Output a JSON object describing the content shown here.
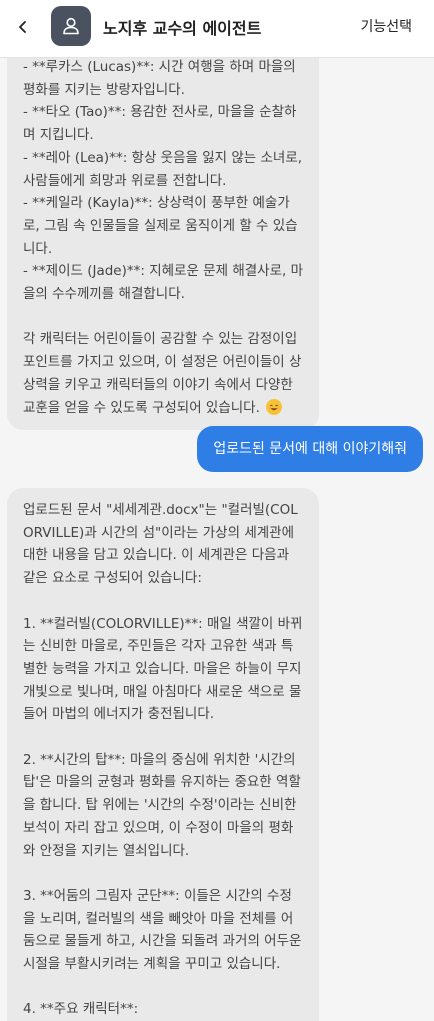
{
  "header": {
    "title": "노지후 교수의 에이전트",
    "feature_button": "기능선택"
  },
  "icons": {
    "back": "chevron-left-icon",
    "avatar": "user-icon",
    "emoji": "smiling-face-emoji"
  },
  "colors": {
    "user_bubble": "#2f7ee6",
    "ai_bubble": "#e9e9e9",
    "avatar_bg": "#4a5260"
  },
  "messages": [
    {
      "role": "assistant",
      "text": "- **루카스 (Lucas)**: 시간 여행을 하며 마을의 평화를 지키는 방랑자입니다.\n- **타오 (Tao)**: 용감한 전사로, 마을을 순찰하며 지킵니다.\n- **레아 (Lea)**: 항상 웃음을 잃지 않는 소녀로, 사람들에게 희망과 위로를 전합니다.\n- **케일라 (Kayla)**: 상상력이 풍부한 예술가로, 그림 속 인물들을 실제로 움직이게 할 수 있습니다.\n- **제이드 (Jade)**: 지혜로운 문제 해결사로, 마을의 수수께끼를 해결합니다.\n\n각 캐릭터는 어린이들이 공감할 수 있는 감정이입 포인트를 가지고 있으며, 이 설정은 어린이들이 상상력을 키우고 캐릭터들의 이야기 속에서 다양한 교훈을 얻을 수 있도록 구성되어 있습니다."
    },
    {
      "role": "user",
      "text": "업로드된 문서에 대해 이야기해줘"
    },
    {
      "role": "assistant",
      "text": "업로드된 문서 \"세세계관.docx\"는 \"컬러빌(COLORVILLE)과 시간의 섬\"이라는 가상의 세계관에 대한 내용을 담고 있습니다. 이 세계관은 다음과 같은 요소로 구성되어 있습니다:\n\n1. **컬러빌(COLORVILLE)**: 매일 색깔이 바뀌는 신비한 마을로, 주민들은 각자 고유한 색과 특별한 능력을 가지고 있습니다. 마을은 하늘이 무지개빛으로 빛나며, 매일 아침마다 새로운 색으로 물들어 마법의 에너지가 충전됩니다.\n\n2. **시간의 탑**: 마을의 중심에 위치한 '시간의 탑'은 마을의 균형과 평화를 유지하는 중요한 역할을 합니다. 탑 위에는 '시간의 수정'이라는 신비한 보석이 자리 잡고 있으며, 이 수정이 마을의 평화와 안정을 지키는 열쇠입니다.\n\n3. **어둠의 그림자 군단**: 이들은 시간의 수정을 노리며, 컬러빌의 색을 빼앗아 마을 전체를 어둠으로 물들게 하고, 시간을 되돌려 과거의 어두운 시절을 부활시키려는 계획을 꾸미고 있습니다.\n\n4. **주요 캐릭터**:"
    }
  ]
}
